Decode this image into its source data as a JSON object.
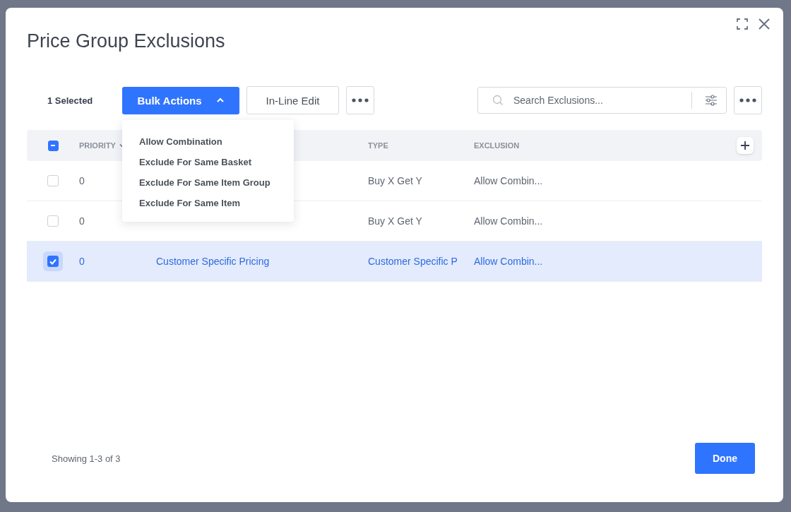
{
  "dialog": {
    "title": "Price Group Exclusions"
  },
  "toolbar": {
    "selection_count": "1 Selected",
    "bulk_actions": {
      "label": "Bulk Actions",
      "expanded": true
    },
    "inline_edit": "In-Line Edit",
    "search": {
      "placeholder": "Search Exclusions..."
    }
  },
  "bulk_menu": [
    "Allow Combination",
    "Exclude For Same Basket",
    "Exclude For Same Item Group",
    "Exclude For Same Item"
  ],
  "table": {
    "select_all_indeterminate": true,
    "columns": [
      "PRIORITY",
      "TYPE",
      "EXCLUSION"
    ],
    "rows": [
      {
        "selected": false,
        "priority": "0",
        "type": "Buy X Get Y",
        "exclusion": "Allow Combin..."
      },
      {
        "selected": false,
        "priority": "0",
        "type": "Buy X Get Y",
        "exclusion": "Allow Combin..."
      },
      {
        "selected": true,
        "priority": "0",
        "name": "Customer Specific Pricing",
        "type": "Customer Specific P",
        "exclusion": "Allow Combin..."
      }
    ]
  },
  "footer": {
    "showing": "Showing 1-3 of 3",
    "done": "Done"
  }
}
